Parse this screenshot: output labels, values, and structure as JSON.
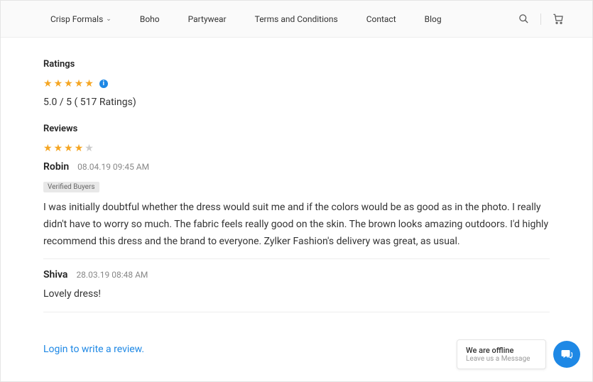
{
  "nav": {
    "items": [
      {
        "label": "Crisp Formals",
        "hasDropdown": true
      },
      {
        "label": "Boho"
      },
      {
        "label": "Partywear"
      },
      {
        "label": "Terms and Conditions"
      },
      {
        "label": "Contact"
      },
      {
        "label": "Blog"
      }
    ]
  },
  "ratings": {
    "title": "Ratings",
    "summary": "5.0 / 5 ( 517 Ratings)"
  },
  "reviews": {
    "title": "Reviews",
    "items": [
      {
        "name": "Robin",
        "date": "08.04.19 09:45 AM",
        "verified": "Verified Buyers",
        "body": "I was initially doubtful whether the dress would suit me and if the colors would be as good as in the photo. I really didn't have to worry so much. The fabric feels really good on the skin. The brown looks amazing outdoors. I'd highly recommend this dress and the brand to everyone. Zylker Fashion's delivery was great, as usual.",
        "stars": 4
      },
      {
        "name": "Shiva",
        "date": "28.03.19 08:48 AM",
        "body": "Lovely dress!"
      }
    ]
  },
  "loginPrompt": "Login to write a review.",
  "chat": {
    "title": "We are offline",
    "subtitle": "Leave us a Message"
  }
}
